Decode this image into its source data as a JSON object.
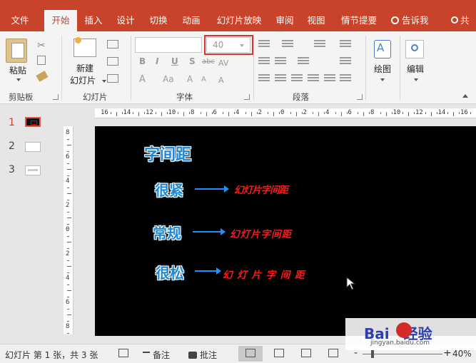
{
  "tabs": [
    "文件",
    "开始",
    "插入",
    "设计",
    "切换",
    "动画",
    "幻灯片放映",
    "审阅",
    "视图",
    "情节提要"
  ],
  "active_tab": "开始",
  "tell_me": "告诉我",
  "share": "共",
  "ribbon": {
    "paste_label": "粘贴",
    "new_slide_label_1": "新建",
    "new_slide_label_2": "幻灯片",
    "font_size": "40",
    "draw_label": "绘图",
    "edit_label": "编辑",
    "format_buttons": [
      "B",
      "I",
      "U",
      "S",
      "abc"
    ],
    "case_label": "Aa",
    "groups": [
      "剪贴板",
      "幻灯片",
      "字体",
      "段落"
    ]
  },
  "thumbnails": [
    "1",
    "2",
    "3"
  ],
  "ruler": {
    "h": [
      "16",
      "14",
      "12",
      "10",
      "8",
      "6",
      "4",
      "2",
      "0",
      "2",
      "4",
      "6",
      "8",
      "10",
      "12",
      "14",
      "16"
    ],
    "v": [
      "8",
      "6",
      "4",
      "2",
      "0",
      "2",
      "4",
      "6",
      "8"
    ]
  },
  "slide": {
    "title": "字间距",
    "rows": [
      {
        "label": "很紧",
        "text": "幻灯片字间距"
      },
      {
        "label": "常规",
        "text": "幻灯片字间距"
      },
      {
        "label": "很松",
        "text": "幻 灯 片 字 间 距"
      }
    ]
  },
  "status": {
    "slide_info": "幻灯片 第 1 张，共 3 张",
    "notes": "备注",
    "comments": "批注",
    "zoom": "40%"
  },
  "watermark": {
    "main": "Bai",
    "main2": "经验",
    "sub": "jingyan.baidu.com"
  },
  "colors": {
    "accent": "#c8432a",
    "slide_bg": "#000000",
    "label_blue": "#1e88d8",
    "red_text": "#ff1a1a"
  }
}
